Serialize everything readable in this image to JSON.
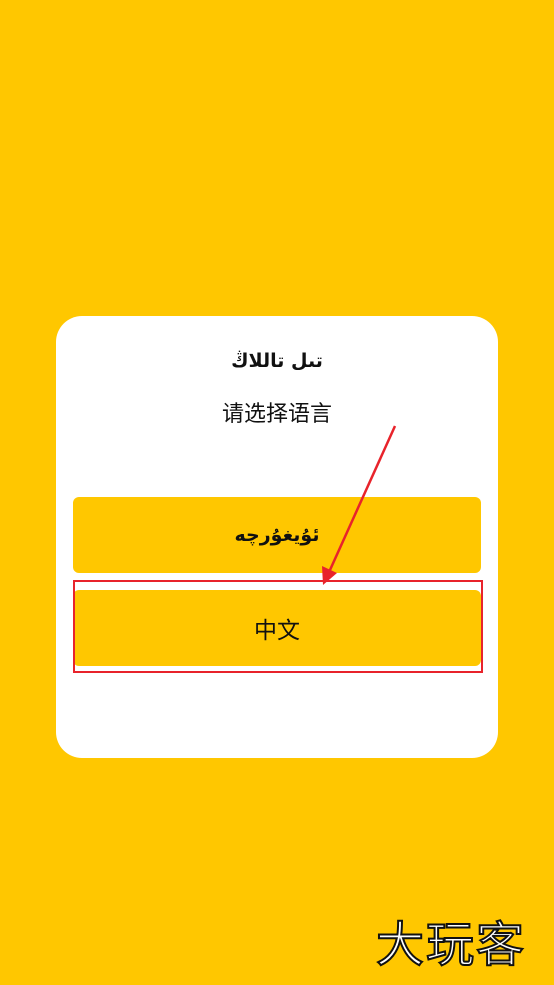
{
  "dialog": {
    "title_uyghur": "تىل تاللاڭ",
    "title_chinese": "请选择语言",
    "buttons": [
      {
        "label": "ئۇيغۇرچە"
      },
      {
        "label": "中文"
      }
    ]
  },
  "watermark": {
    "text": "大玩客"
  },
  "colors": {
    "background": "#FFC700",
    "dialog": "#FFFFFF",
    "button": "#FFC700",
    "annotation": "#E8232B"
  }
}
